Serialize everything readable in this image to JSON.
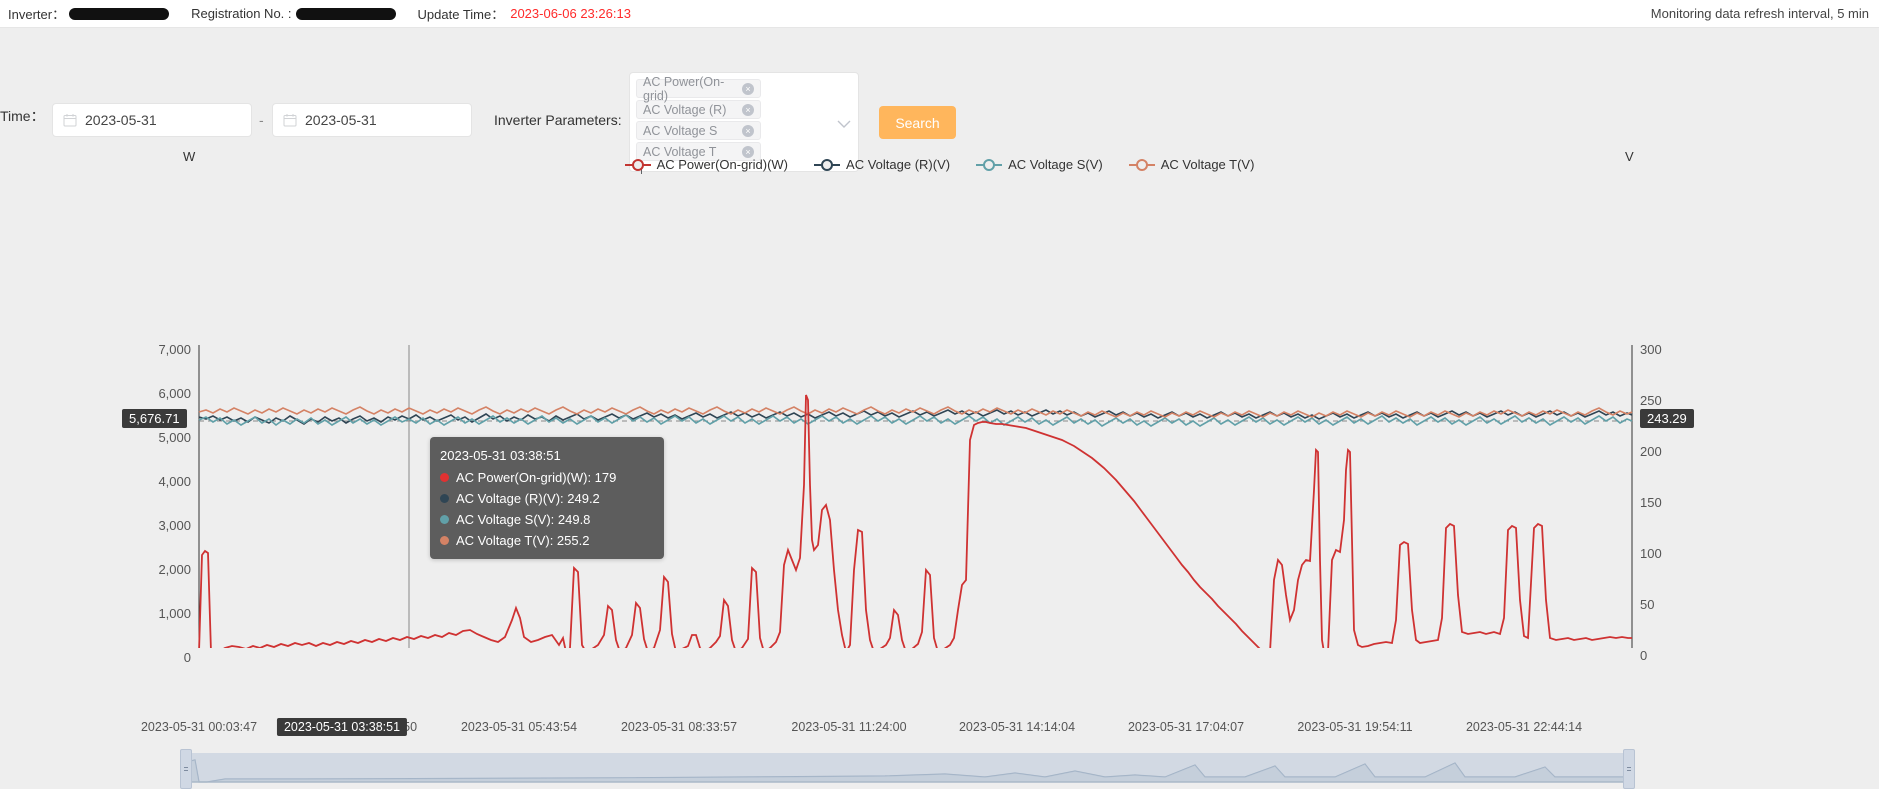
{
  "topbar": {
    "inverter_label": "Inverter：",
    "registration_label": "Registration No. :",
    "update_time_label": "Update Time：",
    "update_time_value": "2023-06-06 23:26:13",
    "refresh_note": "Monitoring data refresh interval, 5 min"
  },
  "filters": {
    "time_label": "Time：",
    "date_start": "2023-05-31",
    "date_end": "2023-05-31",
    "date_separator": "-",
    "param_label": "Inverter Parameters:",
    "param_tags": [
      {
        "label": "AC Power(On-grid)",
        "remove": "×"
      },
      {
        "label": "AC Voltage (R)",
        "remove": "×"
      },
      {
        "label": "AC Voltage S",
        "remove": "×"
      },
      {
        "label": "AC Voltage T",
        "remove": "×"
      }
    ],
    "search_label": "Search"
  },
  "chart_data": {
    "type": "line",
    "title": "",
    "xlabel": "",
    "ylabel": "W",
    "y2label": "V",
    "grid": false,
    "legend_position": "top",
    "ylim": [
      0,
      7000
    ],
    "y2lim": [
      0,
      300
    ],
    "yticks": [
      "0",
      "1,000",
      "2,000",
      "3,000",
      "4,000",
      "5,000",
      "6,000",
      "7,000"
    ],
    "y2ticks": [
      "0",
      "50",
      "100",
      "150",
      "200",
      "250",
      "300"
    ],
    "xticks": [
      "2023-05-31 00:03:47",
      "2023-05-31 02:53:50",
      "2023-05-31 05:43:54",
      "2023-05-31 08:33:57",
      "2023-05-31 11:24:00",
      "2023-05-31 14:14:04",
      "2023-05-31 17:04:07",
      "2023-05-31 19:54:11",
      "2023-05-31 22:44:14"
    ],
    "axis_marker_left": "5,676.71",
    "axis_marker_right": "243.29",
    "axis_marker_x": "2023-05-31 03:38:51",
    "series": [
      {
        "name": "AC Power(On-grid)(W)",
        "color": "#c23531",
        "axis": "left",
        "unit": "W"
      },
      {
        "name": "AC Voltage (R)(V)",
        "color": "#2f4554",
        "axis": "right",
        "unit": "V"
      },
      {
        "name": "AC Voltage S(V)",
        "color": "#61a0a8",
        "axis": "right",
        "unit": "V"
      },
      {
        "name": "AC Voltage T(V)",
        "color": "#d48265",
        "axis": "right",
        "unit": "V"
      }
    ]
  },
  "tooltip": {
    "time": "2023-05-31 03:38:51",
    "rows": [
      {
        "color": "#e03131",
        "text": "AC Power(On-grid)(W): 179"
      },
      {
        "color": "#2f4554",
        "text": "AC Voltage (R)(V): 249.2"
      },
      {
        "color": "#61a0a8",
        "text": "AC Voltage S(V): 249.8"
      },
      {
        "color": "#d48265",
        "text": "AC Voltage T(V): 255.2"
      }
    ]
  },
  "legend": [
    {
      "label": "AC Power(On-grid)(W)",
      "color": "#c23531"
    },
    {
      "label": "AC Voltage (R)(V)",
      "color": "#2f4554"
    },
    {
      "label": "AC Voltage S(V)",
      "color": "#61a0a8"
    },
    {
      "label": "AC Voltage T(V)",
      "color": "#d48265"
    }
  ]
}
